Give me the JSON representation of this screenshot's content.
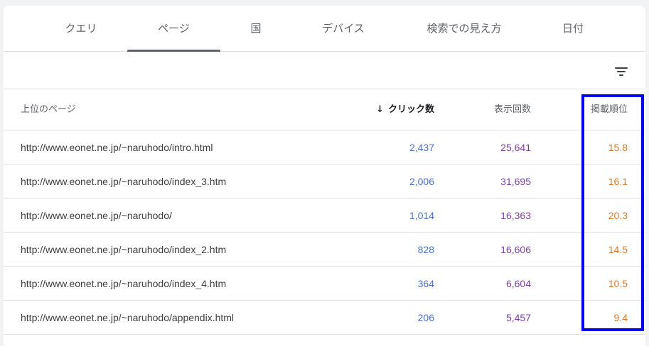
{
  "tabs": [
    {
      "label": "クエリ",
      "active": false
    },
    {
      "label": "ページ",
      "active": true
    },
    {
      "label": "国",
      "active": false
    },
    {
      "label": "デバイス",
      "active": false
    },
    {
      "label": "検索での見え方",
      "active": false
    },
    {
      "label": "日付",
      "active": false
    }
  ],
  "toolbar": {
    "filter_icon": "filter-list-icon"
  },
  "table": {
    "columns": {
      "page": "上位のページ",
      "clicks": "クリック数",
      "impressions": "表示回数",
      "position": "掲載順位"
    },
    "sort_icon": "arrow-down-icon",
    "rows": [
      {
        "page": "http://www.eonet.ne.jp/~naruhodo/intro.html",
        "clicks": "2,437",
        "impressions": "25,641",
        "position": "15.8"
      },
      {
        "page": "http://www.eonet.ne.jp/~naruhodo/index_3.htm",
        "clicks": "2,006",
        "impressions": "31,695",
        "position": "16.1"
      },
      {
        "page": "http://www.eonet.ne.jp/~naruhodo/",
        "clicks": "1,014",
        "impressions": "16,363",
        "position": "20.3"
      },
      {
        "page": "http://www.eonet.ne.jp/~naruhodo/index_2.htm",
        "clicks": "828",
        "impressions": "16,606",
        "position": "14.5"
      },
      {
        "page": "http://www.eonet.ne.jp/~naruhodo/index_4.htm",
        "clicks": "364",
        "impressions": "6,604",
        "position": "10.5"
      },
      {
        "page": "http://www.eonet.ne.jp/~naruhodo/appendix.html",
        "clicks": "206",
        "impressions": "5,457",
        "position": "9.4"
      }
    ]
  },
  "colors": {
    "clicks": "#4a6fc9",
    "impressions": "#7b3fa2",
    "position": "#d4792b",
    "highlight_box": "#0000ee"
  }
}
